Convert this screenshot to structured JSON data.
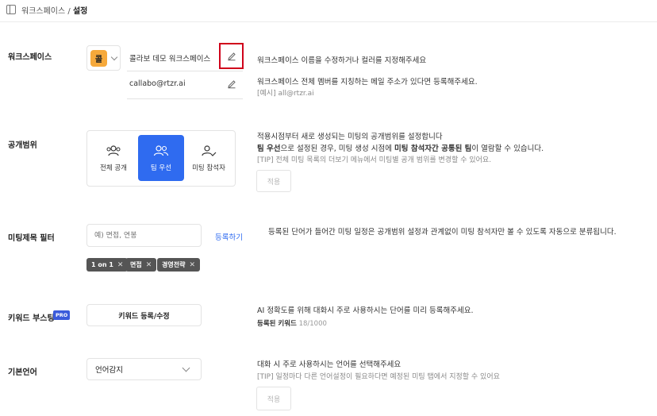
{
  "breadcrumb": {
    "parent": "워크스페이스",
    "separator": "/",
    "current": "설정"
  },
  "workspace": {
    "label": "워크스페이스",
    "avatar_char": "콜",
    "name_value": "콜라보 데모 워크스페이스",
    "email_value": "callabo@rtzr.ai",
    "desc_name": "워크스페이스 이름을 수정하거나 컬러를 지정해주세요",
    "desc_email": "워크스페이스 전체 멤버를 지칭하는 메일 주소가 있다면 등록해주세요.",
    "hint_email": "[예시] all@rtzr.ai"
  },
  "scope": {
    "label": "공개범위",
    "options": [
      {
        "label": "전체 공개",
        "icon": "group-icon",
        "active": false
      },
      {
        "label": "팀 우선",
        "icon": "team-icon",
        "active": true
      },
      {
        "label": "미팅 참석자",
        "icon": "attendee-check-icon",
        "active": false
      }
    ],
    "desc_line1": "적용시점부터 새로 생성되는 미팅의 공개범위를 설정합니다",
    "desc_line2_bold1": "팀 우선",
    "desc_line2_mid": "으로 설정된 경우, 미팅 생성 시점에 ",
    "desc_line2_bold2": "미팅 참석자간 공통된 팀",
    "desc_line2_end": "이 열람할 수 있습니다.",
    "tip": "[TIP] 전체 미팅 목록의 더보기 메뉴에서 미팅별 공개 범위를 변경할 수 있어요.",
    "apply_label": "적용"
  },
  "filter": {
    "label": "미팅제목 필터",
    "placeholder": "예) 면접, 연봉",
    "register_label": "등록하기",
    "chips": [
      "1 on 1",
      "면접",
      "경영전략"
    ],
    "desc": "등록된 단어가 들어간 미팅 일정은 공개범위 설정과 관계없이 미팅 참석자만 볼 수 있도록 자동으로 분류됩니다."
  },
  "keyword": {
    "label": "키워드 부스팅",
    "badge": "PRO",
    "button_label": "키워드 등록/수정",
    "desc": "AI 정확도를 위해 대화시 주로 사용하시는 단어를 미리 등록해주세요.",
    "count_label": "등록된 키워드",
    "count_value": "18/1000"
  },
  "language": {
    "label": "기본언어",
    "selected": "언어감지",
    "desc": "대화 시 주로 사용하시는 언어를 선택해주세요",
    "tip": "[TIP] 일정마다 다른 언어설정이 필요하다면 예정된 미팅 탭에서 지정할 수 있어요",
    "apply_label": "적용"
  },
  "colors": {
    "accent": "#2f6bf0",
    "avatar": "#f6a93b",
    "highlight": "#d0021b",
    "chip": "#555555",
    "pro": "#3b5bdb"
  }
}
